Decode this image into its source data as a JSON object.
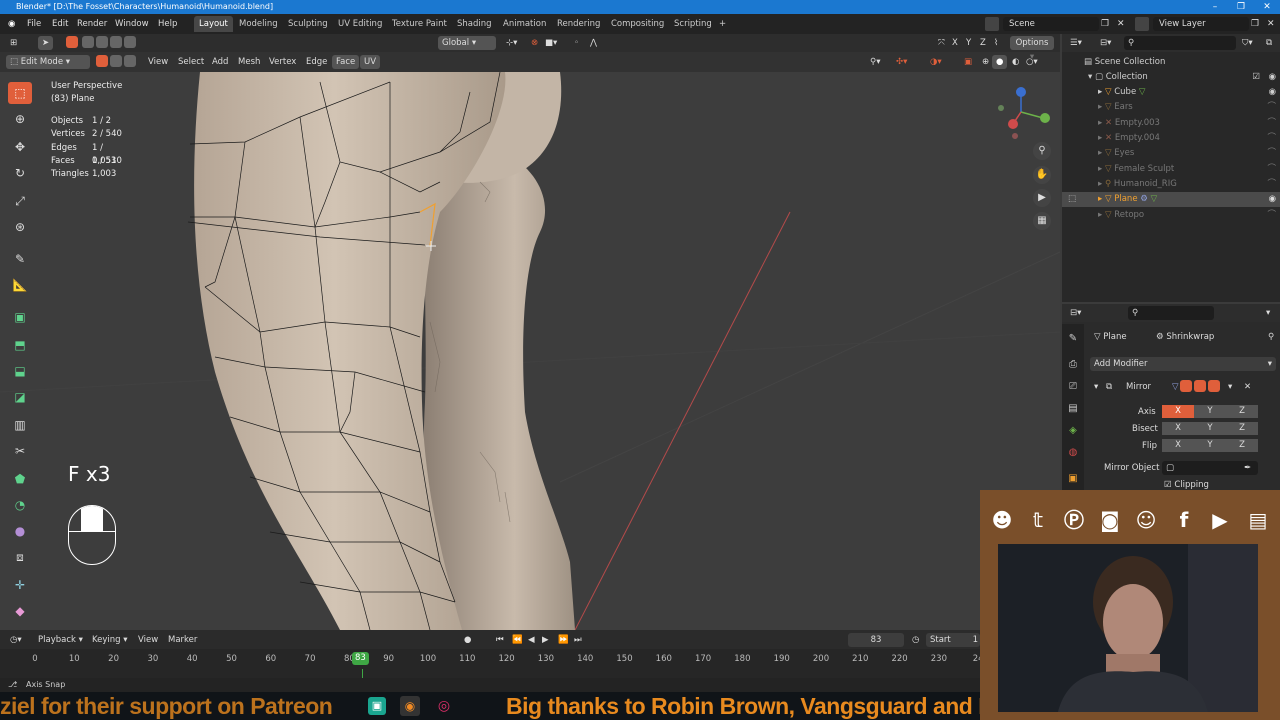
{
  "window": {
    "title": "Blender* [D:\\The Fosset\\Characters\\Humanoid\\Humanoid.blend]",
    "controls": [
      "–",
      "❐",
      "✕"
    ]
  },
  "menubar": {
    "menus": [
      "File",
      "Edit",
      "Render",
      "Window",
      "Help"
    ],
    "workspaces": [
      "Layout",
      "Modeling",
      "Sculpting",
      "UV Editing",
      "Texture Paint",
      "Shading",
      "Animation",
      "Rendering",
      "Compositing",
      "Scripting"
    ],
    "active_workspace": "Layout",
    "add_tab": "+",
    "scene": "Scene",
    "view_layer": "View Layer"
  },
  "header3d": {
    "orientation": "Global",
    "options": "Options",
    "axes": [
      "X",
      "Y",
      "Z"
    ],
    "mode": "Edit Mode",
    "menus": [
      "View",
      "Select",
      "Add",
      "Mesh",
      "Vertex",
      "Edge",
      "Face",
      "UV"
    ]
  },
  "viewport": {
    "view_name": "User Perspective",
    "object_name": "(83) Plane",
    "stats": [
      {
        "label": "Objects",
        "value": "1 / 2"
      },
      {
        "label": "Vertices",
        "value": "2 / 540"
      },
      {
        "label": "Edges",
        "value": "1 / 1,053"
      },
      {
        "label": "Faces",
        "value": "0 / 510"
      },
      {
        "label": "Triangles",
        "value": "1,003"
      }
    ],
    "keycast": "F x3"
  },
  "outliner": {
    "root": "Scene Collection",
    "collection": "Collection",
    "items": [
      {
        "name": "Cube",
        "dim": false,
        "selected": false
      },
      {
        "name": "Ears",
        "dim": true,
        "selected": false
      },
      {
        "name": "Empty.003",
        "dim": true,
        "selected": false
      },
      {
        "name": "Empty.004",
        "dim": true,
        "selected": false
      },
      {
        "name": "Eyes",
        "dim": true,
        "selected": false
      },
      {
        "name": "Female Sculpt",
        "dim": true,
        "selected": false
      },
      {
        "name": "Humanoid_RIG",
        "dim": true,
        "selected": false
      },
      {
        "name": "Plane",
        "dim": false,
        "selected": true
      },
      {
        "name": "Retopo",
        "dim": true,
        "selected": false
      }
    ]
  },
  "properties": {
    "object": "Plane",
    "modifier_name": "Shrinkwrap",
    "add_modifier": "Add Modifier",
    "mirror_label": "Mirror",
    "axis_label": "Axis",
    "bisect_label": "Bisect",
    "flip_label": "Flip",
    "mirror_object_label": "Mirror Object",
    "clipping_label": "Clipping",
    "xyz": [
      "X",
      "Y",
      "Z"
    ]
  },
  "timeline": {
    "menus": [
      "Playback",
      "Keying",
      "View",
      "Marker"
    ],
    "current_frame": "83",
    "current_frame_marker": "83",
    "start_label": "Start",
    "start_value": "1",
    "ticks": [
      "0",
      "10",
      "20",
      "30",
      "40",
      "50",
      "60",
      "70",
      "80",
      "90",
      "100",
      "110",
      "120",
      "130",
      "140",
      "150",
      "160",
      "170",
      "180",
      "190",
      "200",
      "210",
      "220",
      "230",
      "24"
    ]
  },
  "statusbar": {
    "text": "Axis Snap"
  },
  "stream": {
    "marquee_right": "Big thanks to Robin Brown, Vangsguard and P",
    "marquee_left": "ziel for their support on Patreon"
  },
  "colors": {
    "accent": "#e05f3b",
    "title_blue": "#1b78d0",
    "selection_orange": "#f0a030",
    "frame_green": "#3fa745",
    "marquee_orange": "#e88a1f"
  }
}
